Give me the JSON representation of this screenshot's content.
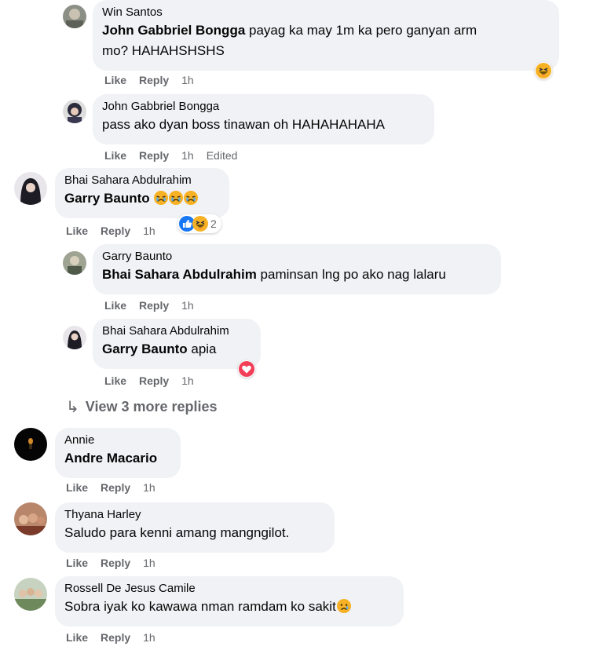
{
  "comments": [
    {
      "author": "Win Santos",
      "mention": "John Gabbriel Bongga",
      "text_line1": " payag ka may 1m ka pero ganyan arm",
      "text_line2": "mo? HAHAHSHSHS",
      "like": "Like",
      "reply": "Reply",
      "time": "1h"
    },
    {
      "author": "John Gabbriel Bongga",
      "text": "pass ako dyan boss tinawan oh HAHAHAHAHA",
      "like": "Like",
      "reply": "Reply",
      "time": "1h",
      "edited": "Edited"
    },
    {
      "author": "Bhai Sahara Abdulrahim",
      "mention": "Garry Baunto",
      "like": "Like",
      "reply": "Reply",
      "time": "1h",
      "reaction_count": "2"
    },
    {
      "author": "Garry Baunto",
      "mention": "Bhai Sahara Abdulrahim",
      "text": " paminsan lng po ako nag lalaru",
      "like": "Like",
      "reply": "Reply",
      "time": "1h"
    },
    {
      "author": "Bhai Sahara Abdulrahim",
      "mention": "Garry Baunto",
      "text": " apia",
      "like": "Like",
      "reply": "Reply",
      "time": "1h"
    },
    {
      "author": "Annie",
      "mention": "Andre Macario",
      "like": "Like",
      "reply": "Reply",
      "time": "1h"
    },
    {
      "author": "Thyana Harley",
      "text": "Saludo para kenni amang mangngilot.",
      "like": "Like",
      "reply": "Reply",
      "time": "1h"
    },
    {
      "author": "Rossell De Jesus Camile",
      "text": "Sobra iyak ko kawawa nman ramdam ko sakit",
      "like": "Like",
      "reply": "Reply",
      "time": "1h"
    }
  ],
  "view_more": {
    "arrow": "↳",
    "label": "View 3 more replies"
  },
  "colors": {
    "bubble": "#f0f2f5",
    "meta": "#65676b",
    "text": "#050505",
    "like_blue": "#1877f2",
    "love_red": "#f33e58",
    "haha_yellow": "#f7b125"
  }
}
